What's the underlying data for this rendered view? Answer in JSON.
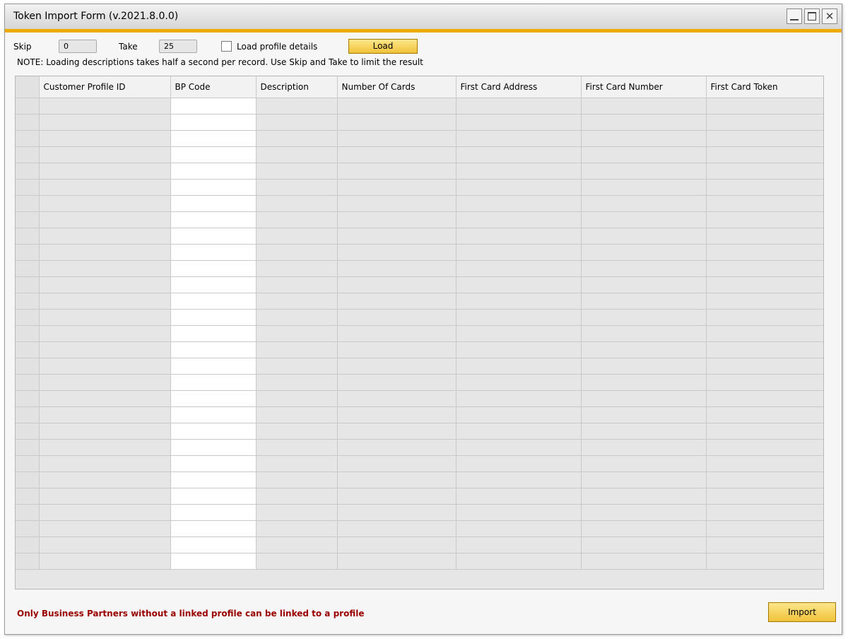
{
  "window": {
    "title": "Token Import Form (v.2021.8.0.0)",
    "buttons": {
      "minimize": "minimize",
      "maximize": "maximize",
      "close": "✕"
    }
  },
  "toolbar": {
    "skip_label": "Skip",
    "skip_value": "0",
    "take_label": "Take",
    "take_value": "25",
    "load_details_label": "Load profile details",
    "load_details_checked": false,
    "load_button": "Load"
  },
  "note": "NOTE: Loading descriptions takes half a second per record. Use Skip and Take to limit the result",
  "grid": {
    "columns": [
      "Customer Profile ID",
      "BP Code",
      "Description",
      "Number Of Cards",
      "First Card Address",
      "First Card Number",
      "First Card Token"
    ]
  },
  "footer": {
    "message": "Only Business Partners without a linked profile can be linked to a profile",
    "import_button": "Import"
  },
  "colors": {
    "accent_bar": "#f0ab00",
    "button_face": "#f0c23a",
    "warning_text": "#9a0000"
  }
}
